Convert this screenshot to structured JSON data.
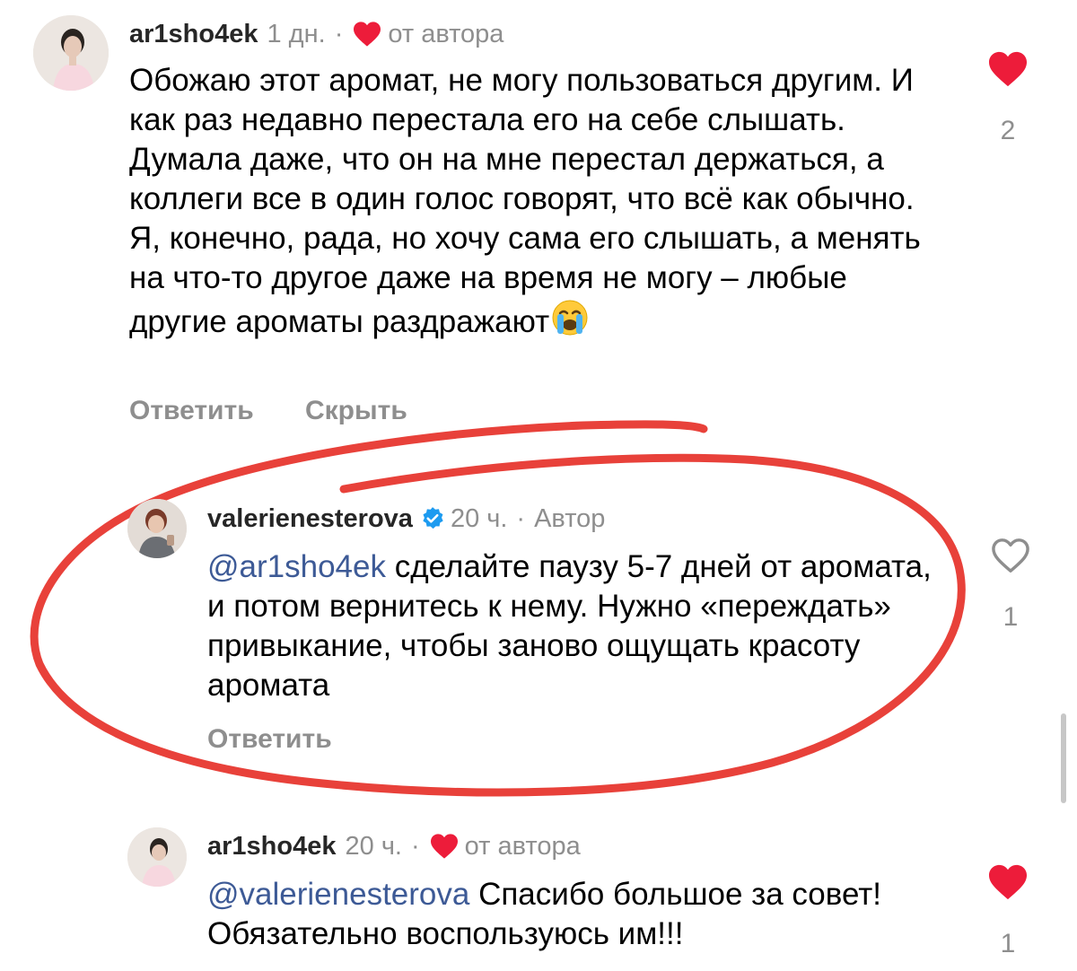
{
  "colors": {
    "username": "#262626",
    "secondary": "#8e8e8e",
    "mention": "#3d5a96",
    "heart_red": "#ed1c3a",
    "verified_blue": "#1d9bf0",
    "annotation_red": "#e8413a"
  },
  "comments": [
    {
      "username": "ar1sho4ek",
      "time": "1 дн.",
      "separator": "·",
      "badge_icon": "heart-filled-icon",
      "badge_text": "от автора",
      "text": "Обожаю этот аромат, не могу пользоваться другим. И как раз недавно перестала его на себе слышать. Думала даже, что он на мне перестал держаться, а коллеги все в один голос говорят, что всё как обычно. Я, конечно, рада, но хочу сама его слышать, а менять на что-то другое даже на время не могу – любые другие ароматы раздражают",
      "emoji": "😭",
      "actions": [
        "Ответить",
        "Скрыть"
      ],
      "like_icon": "heart-filled-icon",
      "likes": "2"
    },
    {
      "username": "valerienesterova",
      "verified_icon": "verified-badge-icon",
      "time": "20 ч.",
      "separator": "·",
      "badge_text": "Автор",
      "mention": "@ar1sho4ek",
      "text": " сделайте паузу 5-7 дней от аромата, и потом вернитесь к нему. Нужно «переждать» привыкание, чтобы заново ощущать красоту аромата",
      "actions": [
        "Ответить"
      ],
      "like_icon": "heart-outline-icon",
      "likes": "1"
    },
    {
      "username": "ar1sho4ek",
      "time": "20 ч.",
      "separator": "·",
      "badge_icon": "heart-filled-icon",
      "badge_text": "от автора",
      "mention": "@valerienesterova",
      "text": " Спасибо большое за совет! Обязательно воспользуюсь им!!!",
      "like_icon": "heart-filled-icon",
      "likes": "1"
    }
  ]
}
